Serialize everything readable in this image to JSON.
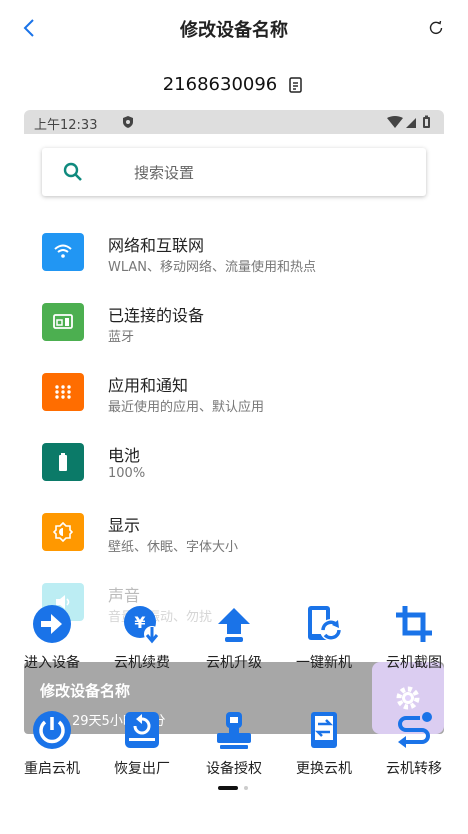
{
  "header": {
    "title": "修改设备名称"
  },
  "device": {
    "id": "2168630096"
  },
  "screen": {
    "statusbar": {
      "time": "上午12:33"
    },
    "search": {
      "placeholder": "搜索设置"
    },
    "items": [
      {
        "title": "网络和互联网",
        "subtitle": "WLAN、移动网络、流量使用和热点",
        "color": "#2196f3",
        "icon": "wifi-icon"
      },
      {
        "title": "已连接的设备",
        "subtitle": "蓝牙",
        "color": "#4caf50",
        "icon": "devices-icon"
      },
      {
        "title": "应用和通知",
        "subtitle": "最近使用的应用、默认应用",
        "color": "#ff6d00",
        "icon": "apps-icon"
      },
      {
        "title": "电池",
        "subtitle": "100%",
        "color": "#0b7a68",
        "icon": "battery-icon"
      },
      {
        "title": "显示",
        "subtitle": "壁纸、休眠、字体大小",
        "color": "#ff9800",
        "icon": "display-icon"
      },
      {
        "title": "声音",
        "subtitle": "音量、振动、勿扰",
        "color": "#26c6da",
        "icon": "sound-icon"
      }
    ]
  },
  "overlay": {
    "title": "修改设备名称",
    "subtitle": "29天5小时52分"
  },
  "actions": [
    {
      "label": "进入设备",
      "icon": "enter-icon"
    },
    {
      "label": "云机续费",
      "icon": "renew-icon"
    },
    {
      "label": "云机升级",
      "icon": "upgrade-icon"
    },
    {
      "label": "一键新机",
      "icon": "new-device-icon"
    },
    {
      "label": "云机截图",
      "icon": "screenshot-icon"
    },
    {
      "label": "重启云机",
      "icon": "power-icon"
    },
    {
      "label": "恢复出厂",
      "icon": "factory-reset-icon"
    },
    {
      "label": "设备授权",
      "icon": "authorize-icon"
    },
    {
      "label": "更换云机",
      "icon": "replace-icon"
    },
    {
      "label": "云机转移",
      "icon": "transfer-icon"
    }
  ],
  "colors": {
    "accent": "#1a73e8",
    "overlay": "#3c3c3c"
  }
}
